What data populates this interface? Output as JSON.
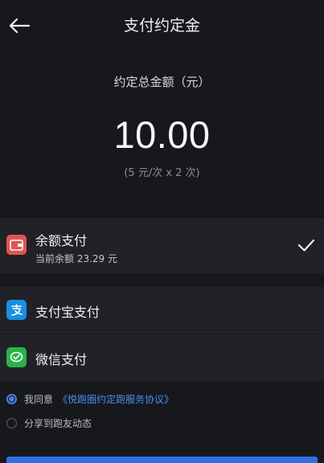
{
  "header": {
    "title": "支付约定金",
    "back_icon": "back-arrow-icon"
  },
  "amount": {
    "label": "约定总金额（元）",
    "value": "10.00",
    "detail": "(5 元/次 x 2 次)"
  },
  "payment_methods": [
    {
      "label": "余额支付",
      "sub": "当前余额 23.29 元",
      "icon": "wallet-icon",
      "selected": true
    },
    {
      "label": "支付宝支付",
      "icon": "alipay-icon",
      "selected": false
    },
    {
      "label": "微信支付",
      "icon": "wechat-pay-icon",
      "selected": false
    }
  ],
  "agreement": {
    "prefix": "我同意",
    "link": "《悦跑圈约定跑服务协议》",
    "checked": true
  },
  "share": {
    "label": "分享到跑友动态",
    "checked": false
  },
  "colors": {
    "background": "#17181c",
    "row": "#212227",
    "accent": "#4a8df0"
  }
}
